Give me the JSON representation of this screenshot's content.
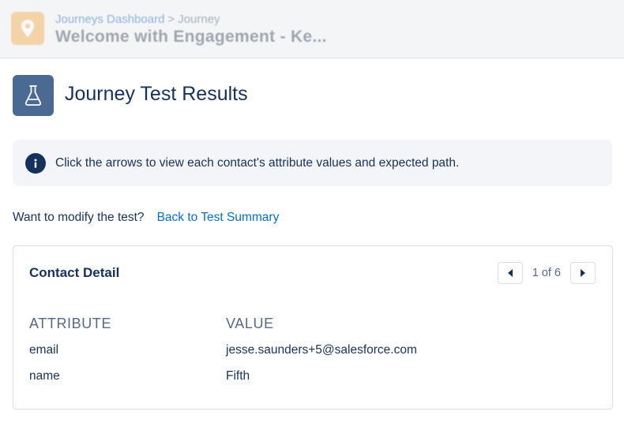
{
  "header": {
    "breadcrumb_link": "Journeys Dashboard",
    "breadcrumb_separator": ">",
    "breadcrumb_current": "Journey",
    "title": "Welcome with Engagement - Ke..."
  },
  "modal": {
    "title": "Journey Test Results"
  },
  "info_banner": {
    "text": "Click the arrows to view each contact's attribute values and expected path."
  },
  "modify": {
    "prompt": "Want to modify the test?",
    "link": "Back to Test Summary"
  },
  "contact_detail": {
    "title": "Contact Detail",
    "pager": "1 of 6",
    "columns": {
      "attribute": "ATTRIBUTE",
      "value": "VALUE"
    },
    "rows": [
      {
        "attribute": "email",
        "value": "jesse.saunders+5@salesforce.com"
      },
      {
        "attribute": "name",
        "value": "Fifth"
      }
    ]
  },
  "colors": {
    "primary_text": "#16325c",
    "link": "#0070d2",
    "title_icon_bg": "#4a6a94",
    "journey_icon_bg": "#f7b86a",
    "banner_bg": "#f3f5f8"
  },
  "icons": {
    "journey": "map-pin-icon",
    "title": "flask-icon",
    "info": "info-icon",
    "prev": "triangle-left-icon",
    "next": "triangle-right-icon"
  }
}
